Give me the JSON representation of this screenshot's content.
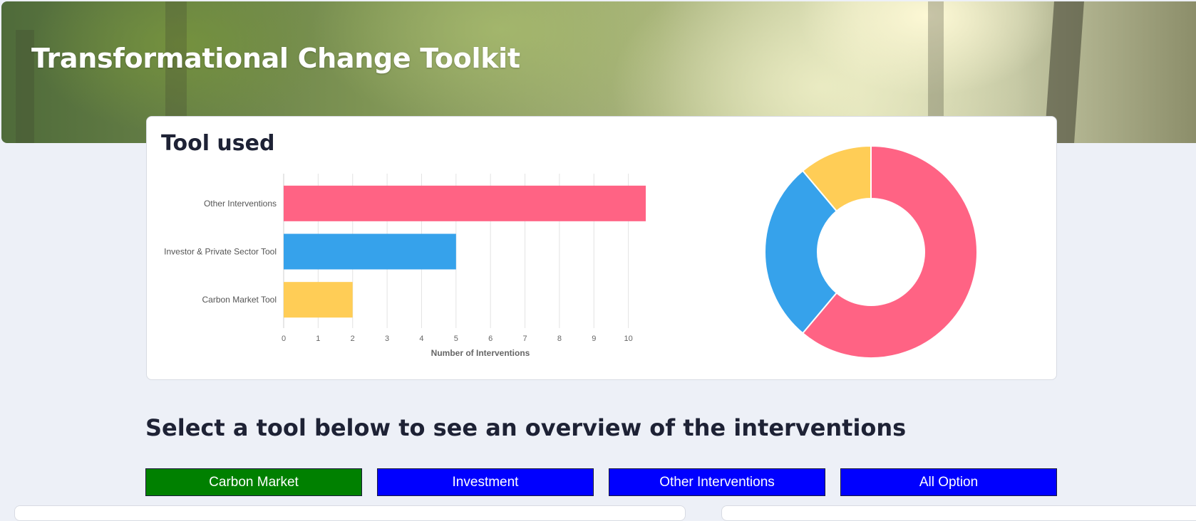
{
  "banner": {
    "title": "Transformational Change Toolkit"
  },
  "card": {
    "title": "Tool used"
  },
  "chart_data": [
    {
      "type": "bar",
      "orientation": "horizontal",
      "categories": [
        "Other Interventions",
        "Investor & Private Sector Tool",
        "Carbon Market Tool"
      ],
      "values": [
        11,
        5,
        2
      ],
      "colors": [
        "#ff6384",
        "#36a2eb",
        "#ffcd56"
      ],
      "xlabel": "Number of Interventions",
      "ylabel": "",
      "xlim": [
        0,
        11
      ],
      "xticks": [
        "0",
        "1",
        "2",
        "3",
        "4",
        "5",
        "6",
        "7",
        "8",
        "9",
        "10",
        "11"
      ],
      "grid": true,
      "legend": "none"
    },
    {
      "type": "pie",
      "style": "doughnut",
      "categories": [
        "Other Interventions",
        "Investor & Private Sector Tool",
        "Carbon Market Tool"
      ],
      "values": [
        11,
        5,
        2
      ],
      "colors": [
        "#ff6384",
        "#36a2eb",
        "#ffcd56"
      ],
      "legend": "none"
    }
  ],
  "section": {
    "heading": "Select a tool below to see an overview of the interventions"
  },
  "buttons": [
    {
      "label": "Carbon Market",
      "color": "#008000"
    },
    {
      "label": "Investment",
      "color": "#0000ff"
    },
    {
      "label": "Other Interventions",
      "color": "#0000ff"
    },
    {
      "label": "All Option",
      "color": "#0000ff"
    }
  ]
}
